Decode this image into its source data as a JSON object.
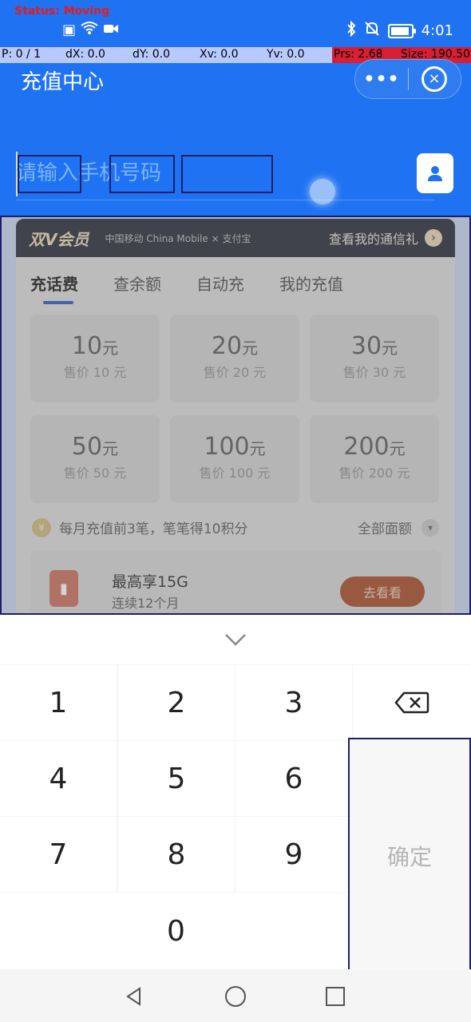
{
  "status_bar": {
    "debug_status": "Status: Moving",
    "time": "4:01"
  },
  "debug_bar": {
    "p": "P: 0 / 1",
    "dx": "dX: 0.0",
    "dy": "dY: 0.0",
    "xv": "Xv: 0.0",
    "yv": "Yv: 0.0",
    "prs": "Prs: 2.68",
    "size": "Size: 190.50"
  },
  "header": {
    "title": "充值中心",
    "more_label": "•••",
    "close_icon": "×"
  },
  "phone": {
    "placeholder": "请输入手机号码"
  },
  "vip_bar": {
    "title": "双V会员",
    "logos": "中国移动 China Mobile × 支付宝",
    "link": "查看我的通信礼",
    "arrow": "›"
  },
  "tabs": [
    {
      "label": "充话费"
    },
    {
      "label": "查余额"
    },
    {
      "label": "自动充"
    },
    {
      "label": "我的充值"
    }
  ],
  "amounts": [
    {
      "value": "10",
      "unit": "元",
      "price": "售价 10 元"
    },
    {
      "value": "20",
      "unit": "元",
      "price": "售价 20 元"
    },
    {
      "value": "30",
      "unit": "元",
      "price": "售价 30 元"
    },
    {
      "value": "50",
      "unit": "元",
      "price": "售价 50 元"
    },
    {
      "value": "100",
      "unit": "元",
      "price": "售价 100 元"
    },
    {
      "value": "200",
      "unit": "元",
      "price": "售价 200 元"
    }
  ],
  "promo": {
    "text": "每月充值前3笔，笔笔得10积分",
    "all": "全部面额"
  },
  "offer": {
    "title": "最高享15G",
    "sub": "连续12个月",
    "button": "去看看"
  },
  "keyboard": {
    "keys": [
      "1",
      "2",
      "3",
      "4",
      "5",
      "6",
      "7",
      "8",
      "9",
      "0"
    ],
    "confirm": "确定"
  }
}
